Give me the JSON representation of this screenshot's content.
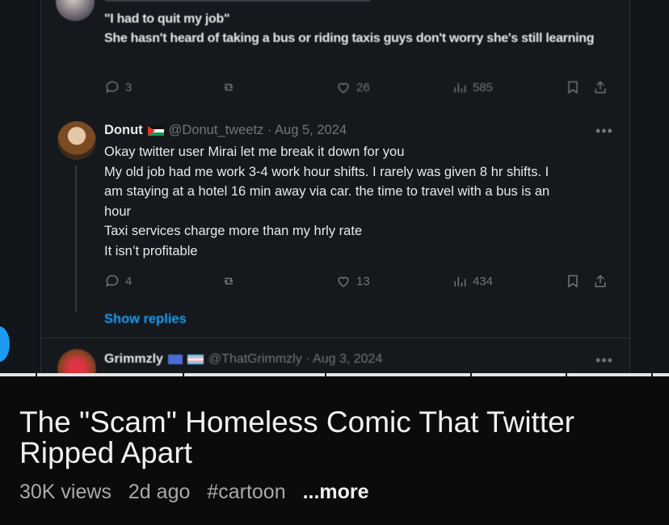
{
  "reply1": {
    "quote": "\"I had to quit my job\"",
    "text": "She hasn't heard of taking a bus or riding taxis guys don't worry she's still learning",
    "comments": "3",
    "likes": "26",
    "views": "585"
  },
  "reply2": {
    "name": "Donut",
    "handle_date": "@Donut_tweetz · Aug 5, 2024",
    "lines": [
      "Okay twitter user Mirai let me break it down for you",
      "My old job had me work 3-4 work hour shifts. I rarely was given 8 hr shifts. I",
      "am staying at a hotel 16 min away via car. the time to travel with a bus is an",
      "hour",
      "Taxi services charge more than my hrly rate",
      "It isn’t profitable"
    ],
    "comments": "4",
    "likes": "13",
    "views": "434",
    "show_replies": "Show replies"
  },
  "reply3": {
    "name": "Grimmzly",
    "handle_date": "@ThatGrimmzly · Aug 3, 2024"
  },
  "video": {
    "title": "The \"Scam\" Homeless Comic That Twitter Ripped Apart",
    "views": "30K views",
    "age": "2d ago",
    "hashtag": "#cartoon",
    "more": "...more"
  },
  "colors": {
    "accent": "#1d9bf0",
    "text": "#e7e9ea",
    "muted": "#71767b"
  }
}
